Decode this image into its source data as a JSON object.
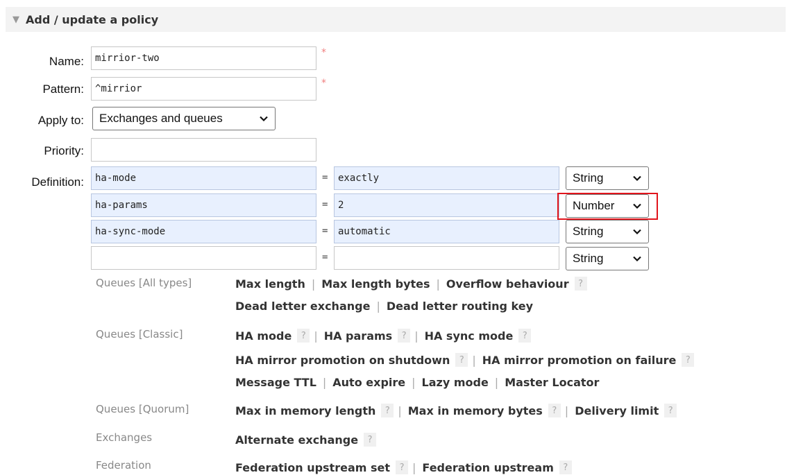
{
  "section": {
    "title": "Add / update a policy",
    "toggle_icon": "triangle-down"
  },
  "form": {
    "name": {
      "label": "Name:",
      "value": "mirrior-two"
    },
    "pattern": {
      "label": "Pattern:",
      "value": "^mirrior"
    },
    "apply_to": {
      "label": "Apply to:",
      "value": "Exchanges and queues"
    },
    "priority": {
      "label": "Priority:",
      "value": ""
    },
    "definition": {
      "label": "Definition:",
      "rows": [
        {
          "key": "ha-mode",
          "eq": "=",
          "value": "exactly",
          "type": "String"
        },
        {
          "key": "ha-params",
          "eq": "=",
          "value": "2",
          "type": "Number"
        },
        {
          "key": "ha-sync-mode",
          "eq": "=",
          "value": "automatic",
          "type": "String"
        },
        {
          "key": "",
          "eq": "=",
          "value": "",
          "type": "String"
        }
      ]
    },
    "required_mark": "*"
  },
  "help": {
    "question": "?",
    "separator": "|",
    "groups": {
      "all": "Queues [All types]",
      "classic": "Queues [Classic]",
      "quorum": "Queues [Quorum]",
      "exchanges": "Exchanges",
      "federation": "Federation"
    },
    "links": {
      "max_length": "Max length",
      "max_length_bytes": "Max length bytes",
      "overflow": "Overflow behaviour",
      "dlx": "Dead letter exchange",
      "dlrk": "Dead letter routing key",
      "ha_mode": "HA mode",
      "ha_params": "HA params",
      "ha_sync": "HA sync mode",
      "ha_promo_shutdown": "HA mirror promotion on shutdown",
      "ha_promo_failure": "HA mirror promotion on failure",
      "message_ttl": "Message TTL",
      "auto_expire": "Auto expire",
      "lazy": "Lazy mode",
      "master_locator": "Master Locator",
      "max_mem_len": "Max in memory length",
      "max_mem_bytes": "Max in memory bytes",
      "delivery_limit": "Delivery limit",
      "alt_exchange": "Alternate exchange",
      "fed_set": "Federation upstream set",
      "fed_up": "Federation upstream"
    }
  },
  "colors": {
    "highlight": "#e1141c",
    "required": "#f08080",
    "input_fill": "#e8f0fe"
  }
}
